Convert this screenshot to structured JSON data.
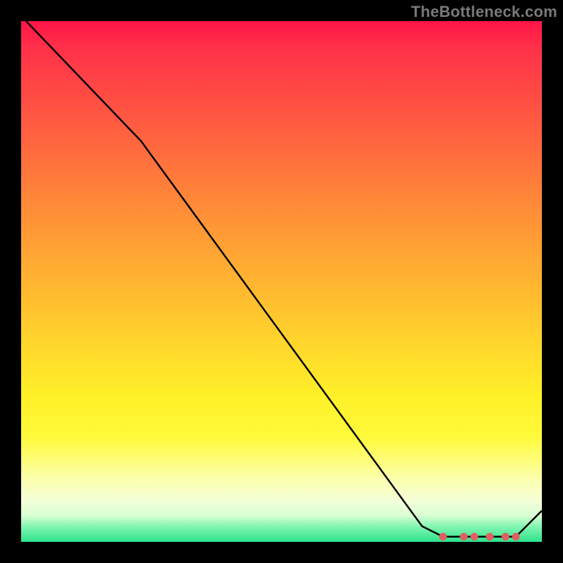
{
  "attribution": "TheBottleneck.com",
  "chart_data": {
    "type": "line",
    "title": "",
    "xlabel": "",
    "ylabel": "",
    "xlim": [
      0,
      100
    ],
    "ylim": [
      0,
      100
    ],
    "x": [
      0,
      23,
      77,
      81,
      85,
      87,
      90,
      93,
      95,
      100
    ],
    "values": [
      101,
      77,
      3,
      1,
      1,
      1,
      1,
      1,
      1,
      6
    ],
    "marker_x": [
      81,
      85,
      87,
      90,
      93,
      95
    ],
    "marker_y": [
      1,
      1,
      1,
      1,
      1,
      1
    ],
    "marker_color": "#e06060"
  }
}
